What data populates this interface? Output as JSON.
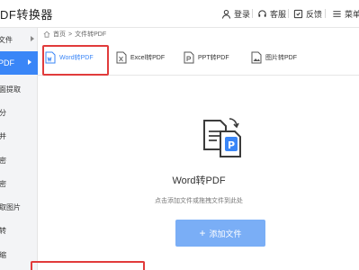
{
  "app": {
    "title": "DF转换器"
  },
  "toolbar": {
    "login_label": "登录",
    "service_label": "客服",
    "feedback_label": "反馈",
    "menu_label": "菜单"
  },
  "sidebar": {
    "items": [
      {
        "label": "文件"
      },
      {
        "label": "PDF"
      },
      {
        "label": "面提取"
      },
      {
        "label": "分"
      },
      {
        "label": "并"
      },
      {
        "label": "密"
      },
      {
        "label": "密"
      },
      {
        "label": "取图片"
      },
      {
        "label": "转"
      },
      {
        "label": "缩"
      }
    ]
  },
  "breadcrumb": {
    "home": "首页",
    "separator": ">",
    "current": "文件转PDF"
  },
  "tabs": [
    {
      "label": "Word转PDF",
      "active": true
    },
    {
      "label": "Excel转PDF",
      "active": false
    },
    {
      "label": "PPT转PDF",
      "active": false
    },
    {
      "label": "图片转PDF",
      "active": false
    }
  ],
  "main": {
    "title": "Word转PDF",
    "hint": "点击添加文件或拖拽文件到此处",
    "add_button": "添加文件",
    "add_icon": "+"
  },
  "colors": {
    "accent": "#3a86f7",
    "highlight": "#e13b3b",
    "button": "#7aaef6"
  }
}
